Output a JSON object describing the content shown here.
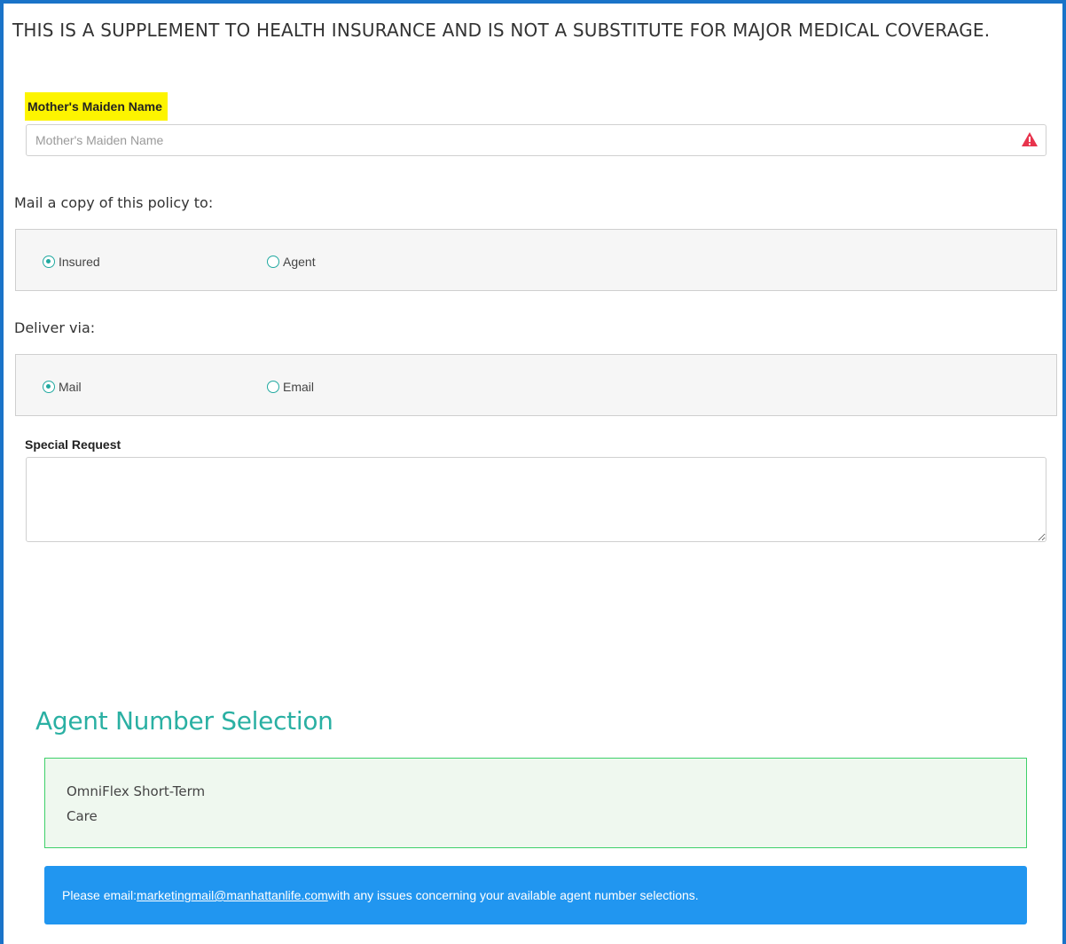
{
  "notice": {
    "text": "THIS IS A SUPPLEMENT TO HEALTH INSURANCE AND IS NOT A SUBSTITUTE FOR MAJOR MEDICAL COVERAGE."
  },
  "maiden_name": {
    "label": "Mother's Maiden Name",
    "placeholder": "Mother's Maiden Name",
    "value": "",
    "status_icon": "warning-triangle-icon",
    "status_color": "#e8344d"
  },
  "mail_copy": {
    "heading": "Mail a copy of this policy to:",
    "options": [
      {
        "label": "Insured",
        "selected": true
      },
      {
        "label": "Agent",
        "selected": false
      }
    ]
  },
  "deliver_via": {
    "heading": "Deliver via:",
    "options": [
      {
        "label": "Mail",
        "selected": true
      },
      {
        "label": "Email",
        "selected": false
      }
    ]
  },
  "special_request": {
    "label": "Special Request",
    "value": ""
  },
  "agent_selection": {
    "title": "Agent Number Selection",
    "product_line1": "OmniFlex Short-Term",
    "product_line2": "Care"
  },
  "info": {
    "prefix": "Please email: ",
    "email": "marketingmail@manhattanlife.com",
    "suffix": " with any issues concerning your available agent number selections."
  },
  "colors": {
    "frame_border": "#1a73c8",
    "highlight": "#fdf400",
    "radio_accent": "#21a9a0",
    "agent_title": "#2ab0a3",
    "agent_box_border": "#3ed06a",
    "info_bar": "#2196f0"
  }
}
